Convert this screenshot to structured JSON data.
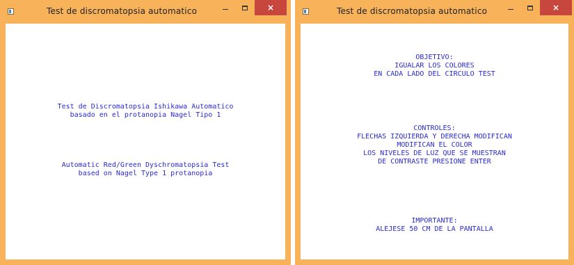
{
  "windows": [
    {
      "title": "Test de discromatopsia automatico",
      "controls": {
        "minimize": "minimize",
        "maximize": "maximize",
        "close": "×"
      },
      "blocks": [
        [
          "Test de Discromatopsia Ishikawa Automatico",
          "basado en el protanopia Nagel Tipo 1"
        ],
        [
          "Automatic Red/Green Dyschromatopsia Test",
          "based on Nagel Type 1 protanopia"
        ]
      ]
    },
    {
      "title": "Test de discromatopsia automatico",
      "controls": {
        "minimize": "minimize",
        "maximize": "maximize",
        "close": "×"
      },
      "blocks": [
        [
          "OBJETIVO:",
          "IGUALAR LOS COLORES",
          "EN CADA LADO DEL CIRCULO TEST"
        ],
        [
          "CONTROLES:",
          "FLECHAS IZQUIERDA Y DERECHA MODIFICAN",
          "MODIFICAN EL COLOR",
          "LOS NIVELES DE LUZ QUE SE MUESTRAN",
          "DE CONTRASTE PRESIONE ENTER"
        ],
        [
          "IMPORTANTE:",
          "ALEJESE 50 CM DE LA PANTALLA"
        ]
      ]
    }
  ]
}
